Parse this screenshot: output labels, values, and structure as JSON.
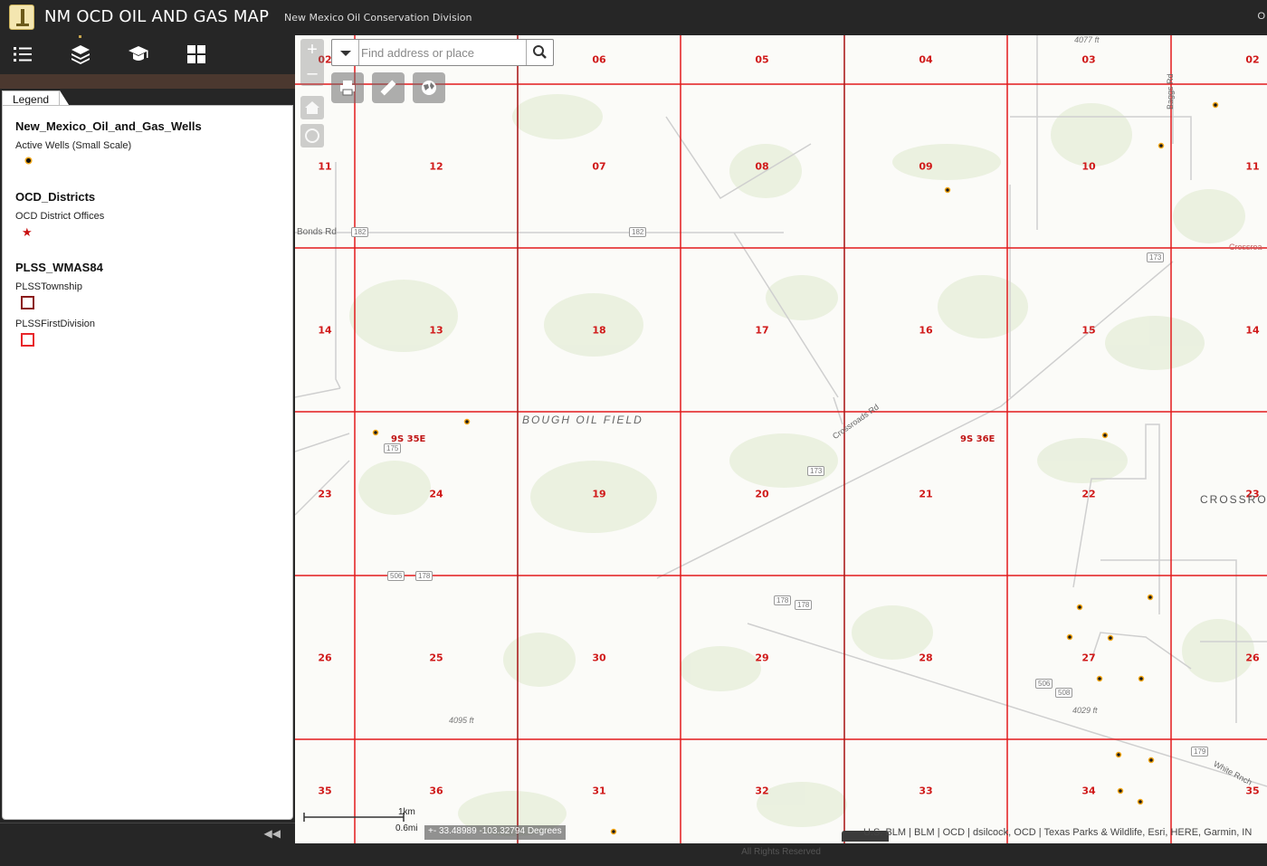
{
  "header": {
    "title": "NM OCD OIL AND GAS MAP",
    "subtitle": "New Mexico Oil Conservation Division",
    "right_text": "O"
  },
  "toolbar": {
    "items": [
      "legend-list-icon",
      "layers-icon",
      "graduation-cap-icon",
      "grid-icon"
    ]
  },
  "legend": {
    "tab_label": "Legend",
    "layers": [
      {
        "title": "New_Mexico_Oil_and_Gas_Wells",
        "entries": [
          {
            "label": "Active Wells (Small Scale)",
            "symbol": "well-dot"
          }
        ]
      },
      {
        "title": "OCD_Districts",
        "entries": [
          {
            "label": "OCD District Offices",
            "symbol": "red-star"
          }
        ]
      },
      {
        "title": "PLSS_WMAS84",
        "entries": [
          {
            "label": "PLSSTownship",
            "symbol": "dark-red-square"
          },
          {
            "label": "PLSSFirstDivision",
            "symbol": "red-square"
          }
        ]
      }
    ],
    "collapse_icon": "double-chevron-left-icon"
  },
  "search": {
    "placeholder": "Find address or place"
  },
  "zoom": {
    "in": "+",
    "out": "–"
  },
  "map": {
    "sections": [
      [
        "02",
        "06",
        "05",
        "04",
        "03",
        "02"
      ],
      [
        "11",
        "12",
        "07",
        "08",
        "09",
        "10",
        "11"
      ],
      [
        "14",
        "13",
        "18",
        "17",
        "16",
        "15",
        "14"
      ],
      [
        "23",
        "24",
        "19",
        "20",
        "21",
        "22",
        "23"
      ],
      [
        "26",
        "25",
        "30",
        "29",
        "28",
        "27",
        "26"
      ],
      [
        "35",
        "36",
        "31",
        "32",
        "33",
        "34",
        "35"
      ]
    ],
    "townships": [
      "9S 35E",
      "9S 36E"
    ],
    "field_label": "BOUGH OIL FIELD",
    "place_label": "CROSSRO",
    "road_labels": {
      "bonds": "Bonds Rd",
      "crossroads": "Crossroads Rd",
      "crossroa": "Crossroa",
      "white_rnch": "White Rnch",
      "vertical": "Baggs Rd"
    },
    "elevations": [
      "4077 ft",
      "4095 ft",
      "4029 ft"
    ],
    "shields": [
      "182",
      "182",
      "173",
      "173",
      "175",
      "506",
      "178",
      "178",
      "506",
      "178",
      "508",
      "179"
    ],
    "scale": {
      "km": "1km",
      "mi": "0.6mi"
    },
    "coordinates": "33.48989 -103.32794 Degrees",
    "attribution": "U.S. BLM | BLM | OCD | dsilcock, OCD | Texas Parks & Wildlife, Esri, HERE, Garmin, IN"
  },
  "footer": {
    "text": "All Rights Reserved"
  },
  "colors": {
    "header": "#262626",
    "section_red": "#d01a1a",
    "grid_line": "#e31a1c",
    "well": "#f5a818"
  }
}
